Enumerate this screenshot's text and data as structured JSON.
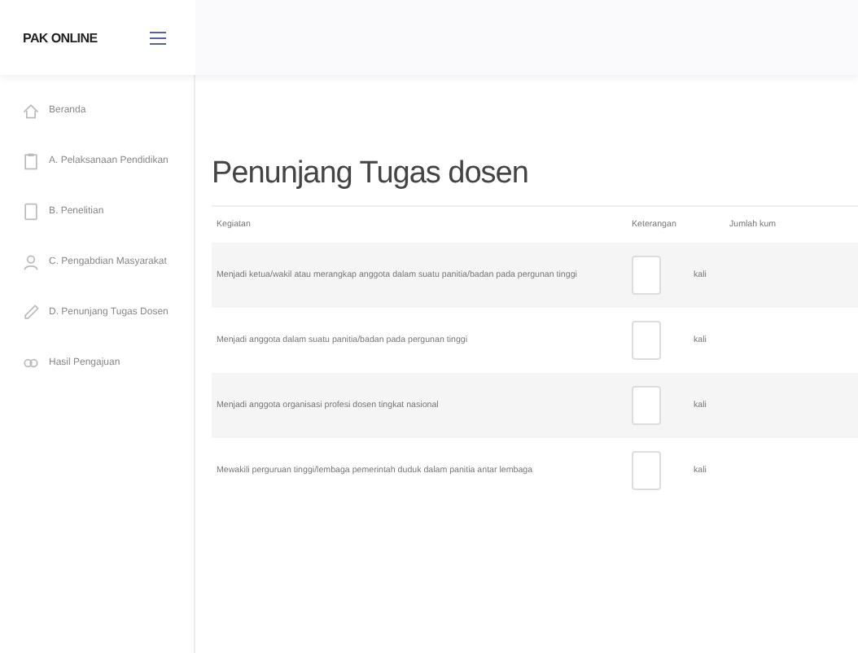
{
  "brand": "PAK ONLINE",
  "sidebar": {
    "items": [
      {
        "label": "Beranda",
        "selected": false
      },
      {
        "label": "A. Pelaksanaan Pendidikan",
        "selected": false
      },
      {
        "label": "B. Penelitian",
        "selected": false
      },
      {
        "label": "C. Pengabdian Masyarakat",
        "selected": false
      },
      {
        "label": "D. Penunjang Tugas Dosen",
        "selected": false
      },
      {
        "label": "Hasil Pengajuan",
        "selected": false
      }
    ]
  },
  "page_title": "Penunjang Tugas dosen",
  "table": {
    "columns": [
      "Kegiatan",
      "Keterangan",
      "Jumlah kum"
    ],
    "rows": [
      {
        "kegiatan": "Menjadi ketua/wakil atau merangkap anggota dalam suatu panitia/badan pada pergunan tinggi",
        "unit": "kali"
      },
      {
        "kegiatan": "Menjadi anggota dalam suatu panitia/badan pada pergunan tinggi",
        "unit": "kali"
      },
      {
        "kegiatan": "Menjadi anggota organisasi profesi dosen tingkat nasional",
        "unit": "kali"
      },
      {
        "kegiatan": "Mewakili perguruan tinggi/lembaga pemerintah duduk dalam panitia antar lembaga",
        "unit": "kali"
      }
    ]
  }
}
